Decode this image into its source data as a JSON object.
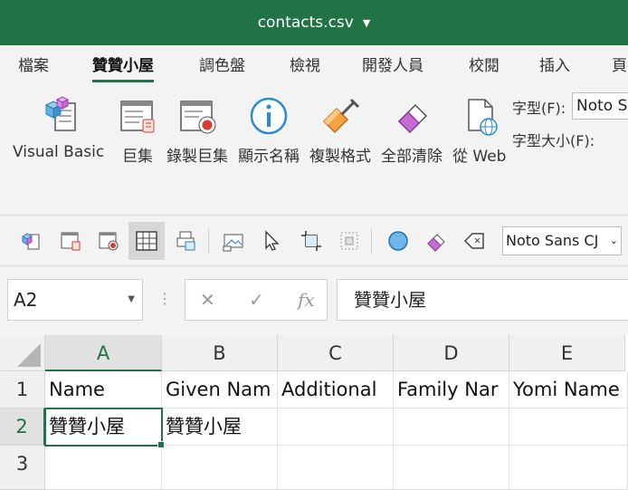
{
  "titlebar": {
    "title": "contacts.csv",
    "caret_icon": "chevron-down-icon"
  },
  "tabs": [
    {
      "label": "檔案"
    },
    {
      "label": "贊贊小屋",
      "active": true
    },
    {
      "label": "調色盤"
    },
    {
      "label": "檢視"
    },
    {
      "label": "開發人員"
    },
    {
      "label": "校閱"
    },
    {
      "label": "插入"
    },
    {
      "label": "頁"
    }
  ],
  "ribbon": {
    "buttons": [
      {
        "label": "Visual Basic",
        "icon": "visual-basic-icon"
      },
      {
        "label": "巨集",
        "icon": "macro-icon"
      },
      {
        "label": "錄製巨集",
        "icon": "record-macro-icon"
      },
      {
        "label": "顯示名稱",
        "icon": "info-icon"
      },
      {
        "label": "複製格式",
        "icon": "format-painter-icon"
      },
      {
        "label": "全部清除",
        "icon": "eraser-icon"
      },
      {
        "label": "從 Web",
        "icon": "from-web-icon"
      }
    ],
    "font_label": "字型(F):",
    "font_value": "Noto S",
    "font_size_label": "字型大小(F):"
  },
  "qat": {
    "font_value": "Noto Sans CJ",
    "icons": [
      "visual-basic-icon",
      "macro-icon",
      "record-macro-icon",
      "grid-icon",
      "print-icon",
      "screenshot-icon",
      "pointer-icon",
      "crop-icon",
      "select-objects-icon",
      "circle-icon",
      "eraser-icon",
      "tag-icon"
    ]
  },
  "formula_bar": {
    "name_box": "A2",
    "cancel": "✕",
    "enter": "✓",
    "fx": "fx",
    "content": "贊贊小屋"
  },
  "sheet": {
    "columns": [
      "A",
      "B",
      "C",
      "D",
      "E"
    ],
    "rows": [
      "1",
      "2",
      "3"
    ],
    "cells": [
      [
        "Name",
        "Given Nam",
        "Additional",
        "Family Nar",
        "Yomi Name"
      ],
      [
        "贊贊小屋",
        "贊贊小屋",
        "",
        "",
        ""
      ],
      [
        "",
        "",
        "",
        "",
        ""
      ]
    ],
    "active_cell": "A2"
  },
  "colors": {
    "accent": "#217346",
    "ribbon_bg": "#f3f3f3"
  }
}
